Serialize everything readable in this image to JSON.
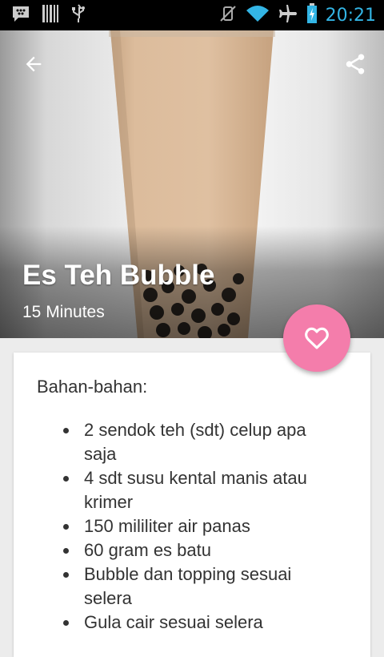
{
  "status_bar": {
    "time": "20:21",
    "left_icons": [
      "blackberry-messenger-icon",
      "barcode-icon",
      "usb-icon"
    ],
    "right_icons": [
      "vibrate-off-icon",
      "wifi-icon",
      "airplane-mode-icon",
      "battery-icon"
    ]
  },
  "hero": {
    "title": "Es Teh Bubble",
    "duration": "15 Minutes",
    "back_icon": "arrow-back-icon",
    "share_icon": "share-icon"
  },
  "fab": {
    "icon": "heart-outline-icon",
    "color": "#f47dab"
  },
  "recipe": {
    "heading": "Bahan-bahan:",
    "ingredients": [
      {
        "text": "2 sendok teh (sdt) celup apa saja",
        "lines": [
          "2 sendok teh (sdt) celup apa",
          "saja"
        ]
      },
      {
        "text": "4 sdt susu kental manis atau krimer",
        "lines": [
          "4 sdt susu kental manis atau",
          "krimer"
        ]
      },
      {
        "text": "150 mililiter air panas",
        "lines": [
          "150 mililiter air panas"
        ]
      },
      {
        "text": "60 gram es batu",
        "lines": [
          "60 gram es batu"
        ]
      },
      {
        "text": "Bubble dan topping sesuai selera",
        "lines": [
          "Bubble dan topping sesuai",
          "selera"
        ]
      },
      {
        "text": "Gula cair sesuai selera",
        "lines": [
          "Gula cair sesuai selera"
        ]
      }
    ]
  },
  "colors": {
    "status_accent": "#33b5e5",
    "tea": "#d8b899",
    "fab": "#f47dab"
  }
}
